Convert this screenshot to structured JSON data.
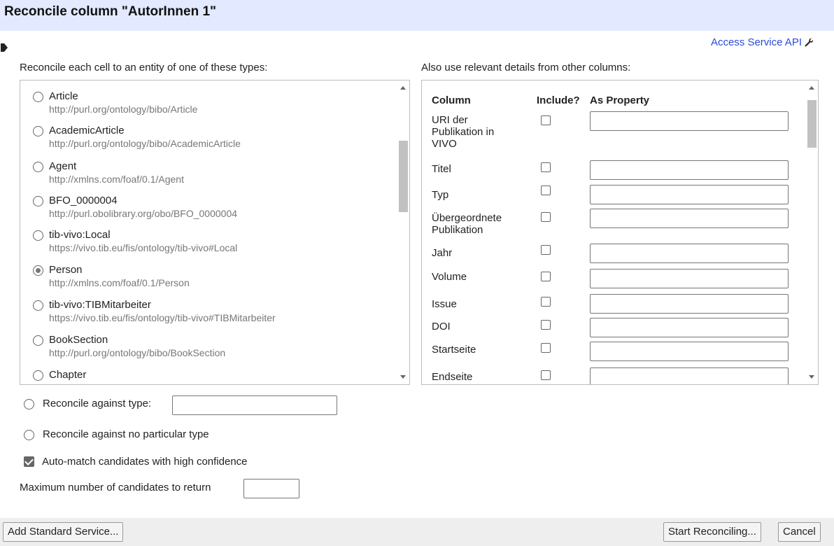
{
  "dialog": {
    "title": "Reconcile column \"AutorInnen 1\""
  },
  "api_link": "Access Service API",
  "types_heading": "Reconcile each cell to an entity of one of these types:",
  "columns_heading": "Also use relevant details from other columns:",
  "types": [
    {
      "name": "Article",
      "uri": "http://purl.org/ontology/bibo/Article",
      "selected": false
    },
    {
      "name": "AcademicArticle",
      "uri": "http://purl.org/ontology/bibo/AcademicArticle",
      "selected": false
    },
    {
      "name": "Agent",
      "uri": "http://xmlns.com/foaf/0.1/Agent",
      "selected": false
    },
    {
      "name": "BFO_0000004",
      "uri": "http://purl.obolibrary.org/obo/BFO_0000004",
      "selected": false
    },
    {
      "name": "tib-vivo:Local",
      "uri": "https://vivo.tib.eu/fis/ontology/tib-vivo#Local",
      "selected": false
    },
    {
      "name": "Person",
      "uri": "http://xmlns.com/foaf/0.1/Person",
      "selected": true
    },
    {
      "name": "tib-vivo:TIBMitarbeiter",
      "uri": "https://vivo.tib.eu/fis/ontology/tib-vivo#TIBMitarbeiter",
      "selected": false
    },
    {
      "name": "BookSection",
      "uri": "http://purl.org/ontology/bibo/BookSection",
      "selected": false
    },
    {
      "name": "Chapter",
      "uri": "",
      "selected": false
    }
  ],
  "columns_table": {
    "headers": {
      "column": "Column",
      "include": "Include?",
      "property": "As Property"
    },
    "rows": [
      {
        "name": "URI der Publikation in VIVO",
        "include": false,
        "property": ""
      },
      {
        "name": "Titel",
        "include": false,
        "property": ""
      },
      {
        "name": "Typ",
        "include": false,
        "property": ""
      },
      {
        "name": "Übergeordnete Publikation",
        "include": false,
        "property": ""
      },
      {
        "name": "Jahr",
        "include": false,
        "property": ""
      },
      {
        "name": "Volume",
        "include": false,
        "property": ""
      },
      {
        "name": "Issue",
        "include": false,
        "property": ""
      },
      {
        "name": "DOI",
        "include": false,
        "property": ""
      },
      {
        "name": "Startseite",
        "include": false,
        "property": ""
      },
      {
        "name": "Endseite",
        "include": false,
        "property": ""
      }
    ]
  },
  "options": {
    "against_type_label": "Reconcile against type:",
    "against_type_value": "",
    "no_type_label": "Reconcile against no particular type",
    "auto_match_label": "Auto-match candidates with high confidence",
    "auto_match_checked": true,
    "max_candidates_label": "Maximum number of candidates to return",
    "max_candidates_value": ""
  },
  "buttons": {
    "add_service": "Add Standard Service...",
    "start": "Start Reconciling...",
    "cancel": "Cancel"
  },
  "colors": {
    "title_bg": "#e3e9ff",
    "link": "#2a4bd6",
    "footer_bg": "#eeeeee"
  }
}
